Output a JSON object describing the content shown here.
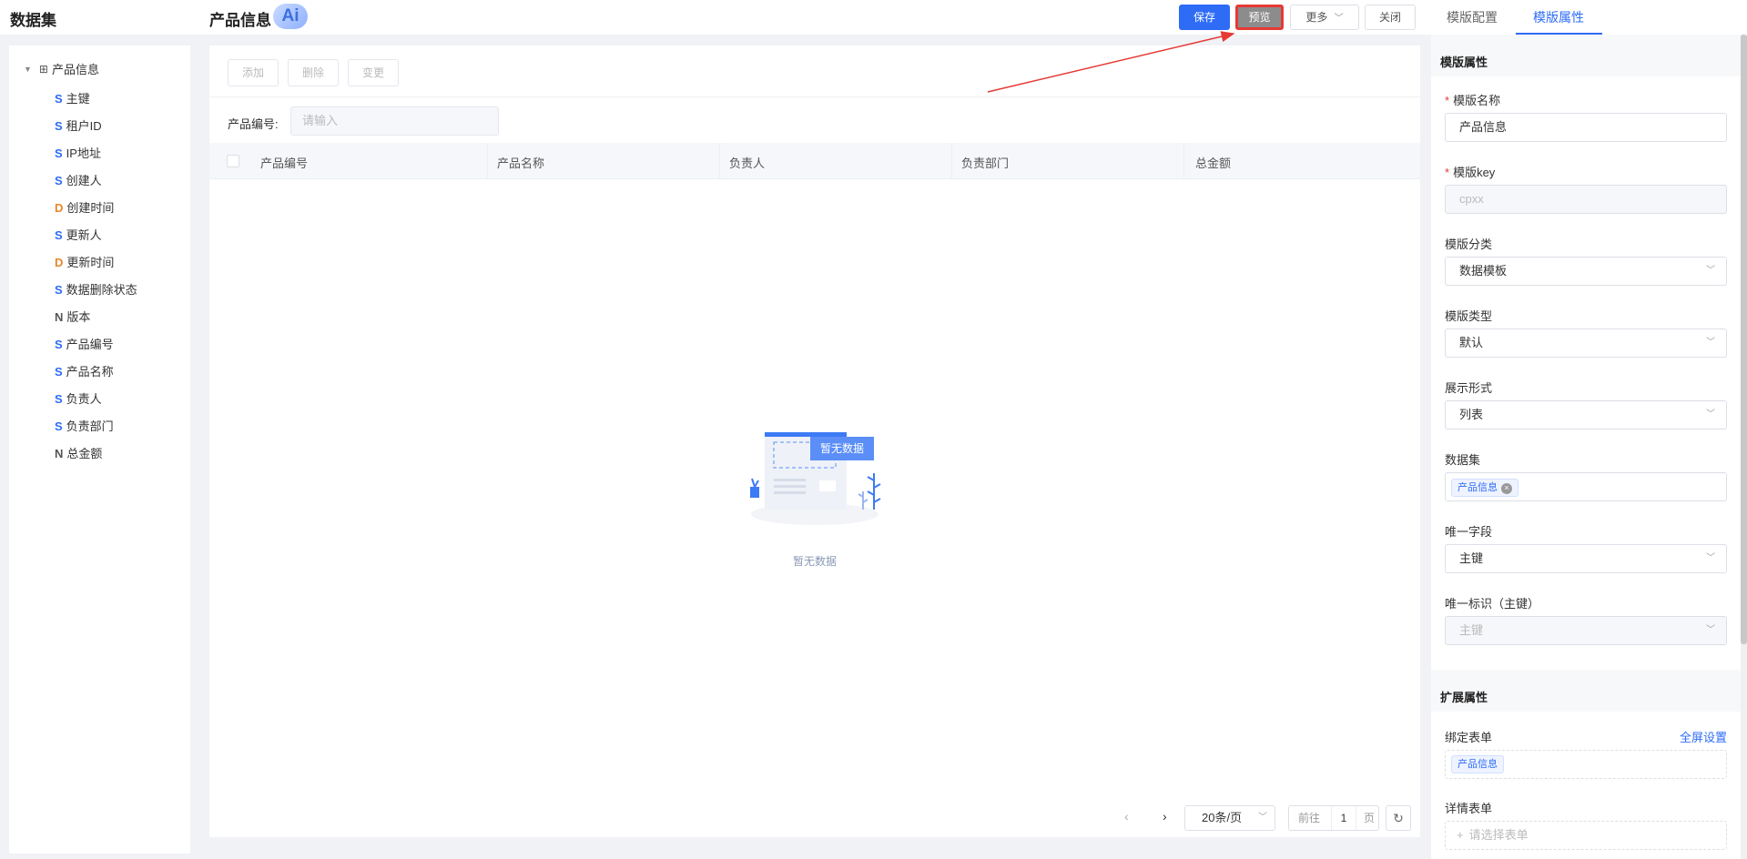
{
  "header": {
    "dataset_title": "数据集",
    "page_title": "产品信息",
    "ai_label": "Ai",
    "save_label": "保存",
    "preview_label": "预览",
    "more_label": "更多",
    "close_label": "关闭",
    "tabs": [
      {
        "label": "模版配置"
      },
      {
        "label": "模版属性",
        "active": true
      }
    ]
  },
  "tree": {
    "root_label": "产品信息",
    "items": [
      {
        "type": "S",
        "label": "主键"
      },
      {
        "type": "S",
        "label": "租户ID"
      },
      {
        "type": "S",
        "label": "IP地址"
      },
      {
        "type": "S",
        "label": "创建人"
      },
      {
        "type": "D",
        "label": "创建时间"
      },
      {
        "type": "S",
        "label": "更新人"
      },
      {
        "type": "D",
        "label": "更新时间"
      },
      {
        "type": "S",
        "label": "数据删除状态"
      },
      {
        "type": "N",
        "label": "版本"
      },
      {
        "type": "S",
        "label": "产品编号"
      },
      {
        "type": "S",
        "label": "产品名称"
      },
      {
        "type": "S",
        "label": "负责人"
      },
      {
        "type": "S",
        "label": "负责部门"
      },
      {
        "type": "N",
        "label": "总金额"
      }
    ]
  },
  "main": {
    "toolbar": {
      "add": "添加",
      "delete": "删除",
      "change": "变更"
    },
    "search_label": "产品编号:",
    "search_placeholder": "请输入",
    "columns": [
      "产品编号",
      "产品名称",
      "负责人",
      "负责部门",
      "总金额"
    ],
    "empty_badge": "暂无数据",
    "empty_text": "暂无数据",
    "pager": {
      "size": "20条/页",
      "goto": "前往",
      "page": "1",
      "page_suffix": "页"
    }
  },
  "panel": {
    "section1_title": "模版属性",
    "name_label": "模版名称",
    "name_value": "产品信息",
    "key_label": "模版key",
    "key_value": "cpxx",
    "category_label": "模版分类",
    "category_value": "数据模板",
    "type_label": "模版类型",
    "type_value": "默认",
    "display_label": "展示形式",
    "display_value": "列表",
    "dataset_label": "数据集",
    "dataset_tag": "产品信息",
    "unique_field_label": "唯一字段",
    "unique_field_value": "主键",
    "unique_id_label": "唯一标识（主键）",
    "unique_id_value": "主键",
    "section2_title": "扩展属性",
    "bind_form_label": "绑定表单",
    "fullscreen_label": "全屏设置",
    "bind_form_tag": "产品信息",
    "detail_form_label": "详情表单",
    "detail_form_placeholder": "请选择表单"
  },
  "colors": {
    "accent": "#2e6cf6",
    "highlight": "#e53935",
    "date_type": "#e8862a"
  }
}
